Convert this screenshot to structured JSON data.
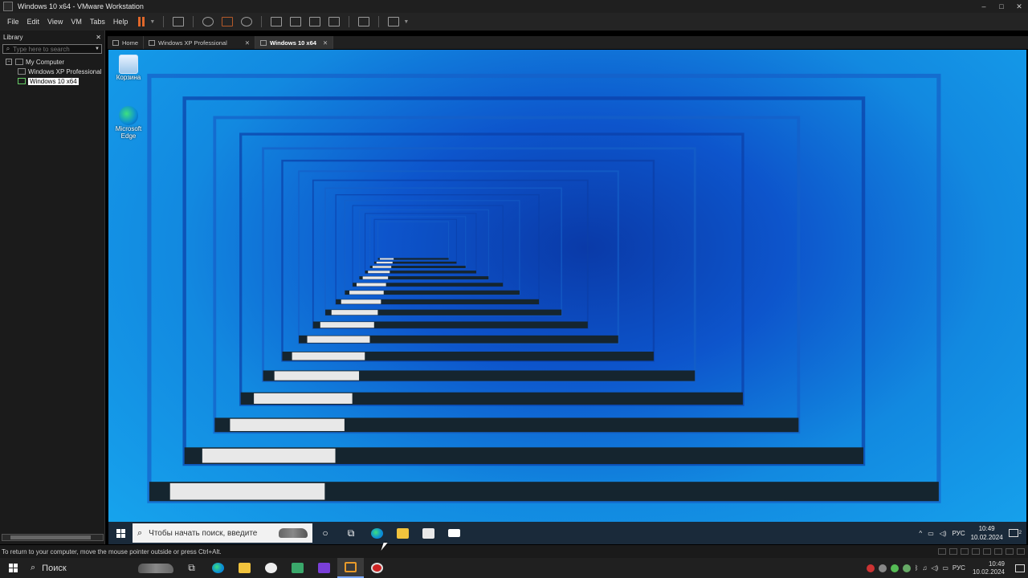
{
  "window": {
    "title": "Windows 10 x64 - VMware Workstation",
    "controls": [
      "–",
      "□",
      "✕"
    ]
  },
  "menu": {
    "items": [
      "File",
      "Edit",
      "View",
      "VM",
      "Tabs",
      "Help"
    ]
  },
  "library": {
    "title": "Library",
    "close": "✕",
    "search_placeholder": "Type here to search",
    "tree": [
      {
        "label": "My Computer",
        "expander": "−"
      },
      {
        "label": "Windows XP Professional",
        "selected": false
      },
      {
        "label": "Windows 10 x64",
        "selected": true
      }
    ]
  },
  "tabs": [
    {
      "label": "Home",
      "active": false
    },
    {
      "label": "Windows XP Professional",
      "active": false,
      "close": "✕"
    },
    {
      "label": "Windows 10 x64",
      "active": true,
      "close": "✕"
    }
  ],
  "guest": {
    "desktop_icons": [
      {
        "label": "Корзина",
        "icon": "recycle-bin-icon"
      },
      {
        "label": "Microsoft Edge",
        "icon": "edge-icon"
      }
    ],
    "taskbar": {
      "search_text": "Чтобы начать поиск, введите",
      "language": "РУС",
      "time": "10:49",
      "date": "10.02.2024",
      "notification_count": "2"
    }
  },
  "status": {
    "message": "To return to your computer, move the mouse pointer outside or press Ctrl+Alt."
  },
  "host": {
    "taskbar": {
      "search_text": "Поиск",
      "language": "РУС",
      "time": "10:49",
      "date": "10.02.2024"
    }
  },
  "colors": {
    "accent": "#e0672a",
    "desktop": "#1289e0"
  }
}
